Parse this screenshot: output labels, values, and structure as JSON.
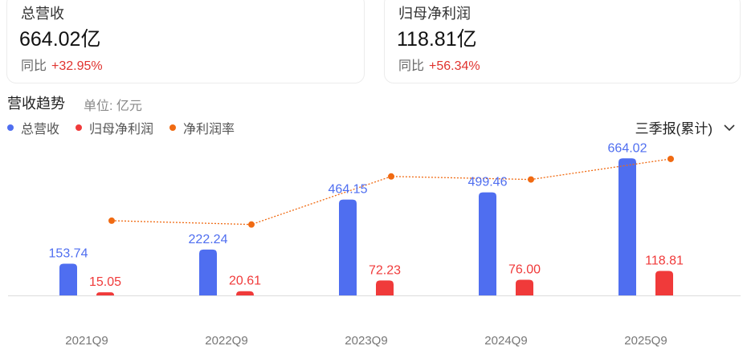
{
  "cards": [
    {
      "title": "总营收",
      "value": "664.02亿",
      "change_label": "同比",
      "change_value": "+32.95%"
    },
    {
      "title": "归母净利润",
      "value": "118.81亿",
      "change_label": "同比",
      "change_value": "+56.34%"
    }
  ],
  "section": {
    "title": "营收趋势",
    "unit": "单位: 亿元"
  },
  "period_select": {
    "selected": "三季报(累计)"
  },
  "colors": {
    "revenue": "#4f6ef0",
    "net_profit": "#f03a3a",
    "margin": "#f06a12",
    "up": "#e0332f"
  },
  "chart_data": {
    "type": "bar",
    "categories": [
      "2021Q9",
      "2022Q9",
      "2023Q9",
      "2024Q9",
      "2025Q9"
    ],
    "series": [
      {
        "name": "总营收",
        "kind": "bar",
        "values": [
          153.74,
          222.24,
          464.15,
          499.46,
          664.02
        ],
        "labels": [
          "153.74",
          "222.24",
          "464.15",
          "499.46",
          "664.02"
        ]
      },
      {
        "name": "归母净利润",
        "kind": "bar",
        "values": [
          15.05,
          20.61,
          72.23,
          76.0,
          118.81
        ],
        "labels": [
          "15.05",
          "20.61",
          "72.23",
          "76.00",
          "118.81"
        ]
      },
      {
        "name": "净利润率",
        "kind": "line",
        "values": [
          9.8,
          9.3,
          15.6,
          15.2,
          17.9
        ]
      }
    ],
    "ylim": [
      0,
      700
    ],
    "grid": false,
    "legend_position": "top-left"
  }
}
